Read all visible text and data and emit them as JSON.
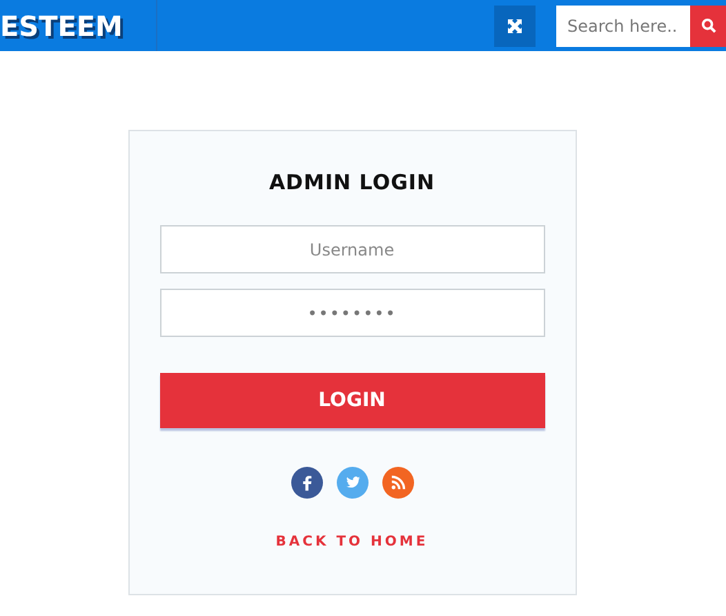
{
  "header": {
    "logo": "ESTEEM",
    "search": {
      "placeholder": "Search here.."
    }
  },
  "login": {
    "title": "ADMIN LOGIN",
    "username": {
      "placeholder": "Username"
    },
    "password": {
      "value": "••••••••"
    },
    "button": "LOGIN",
    "social": [
      {
        "kind": "facebook",
        "color": "#3b5998"
      },
      {
        "kind": "twitter",
        "color": "#55acee"
      },
      {
        "kind": "rss",
        "color": "#f26522"
      }
    ],
    "back_link": "BACK TO HOME"
  }
}
